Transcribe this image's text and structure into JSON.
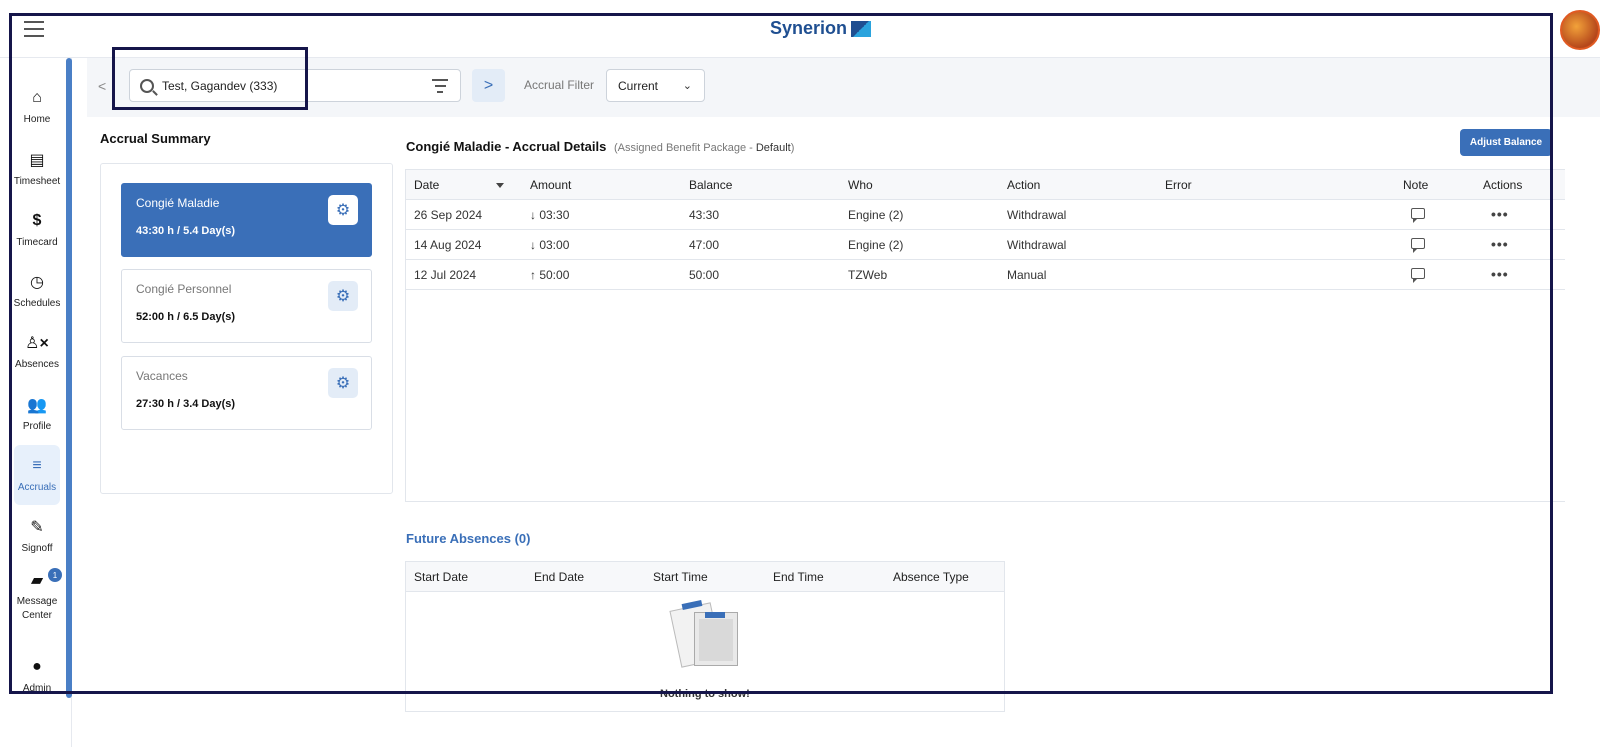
{
  "app": {
    "logo_text": "Synerion",
    "brand_color": "#3a6fb8"
  },
  "sidebar": {
    "items": [
      {
        "label": "Home",
        "icon": "home-icon",
        "glyph": "⌂"
      },
      {
        "label": "Timesheet",
        "icon": "timesheet-icon",
        "glyph": "▤"
      },
      {
        "label": "Timecard",
        "icon": "dollar-icon",
        "glyph": "$"
      },
      {
        "label": "Schedules",
        "icon": "clock-icon",
        "glyph": "◷"
      },
      {
        "label": "Absences",
        "icon": "person-remove-icon",
        "glyph": "♙×"
      },
      {
        "label": "Profile",
        "icon": "people-icon",
        "glyph": "👥"
      },
      {
        "label": "Accruals",
        "icon": "accruals-icon",
        "glyph": "≡"
      },
      {
        "label": "Signoff",
        "icon": "signoff-icon",
        "glyph": "✎"
      },
      {
        "label": "Message\nCenter",
        "icon": "chat-icon",
        "glyph": "▰",
        "badge": "1"
      },
      {
        "label": "Admin",
        "icon": "admin-icon",
        "glyph": "●"
      }
    ]
  },
  "toolbar": {
    "back_glyph": "<",
    "search_value": "Test, Gagandev (333)",
    "next_glyph": ">",
    "accrual_filter_label": "Accrual Filter",
    "accrual_filter_value": "Current"
  },
  "summary": {
    "title": "Accrual Summary",
    "cards": [
      {
        "name": "Congié Maladie",
        "value": "43:30 h / 5.4 Day(s)"
      },
      {
        "name": "Congié Personnel",
        "value": "52:00 h / 6.5 Day(s)"
      },
      {
        "name": "Vacances",
        "value": "27:30 h / 3.4 Day(s)"
      }
    ]
  },
  "details": {
    "title": "Congié Maladie - Accrual Details",
    "sub_prefix": "(Assigned Benefit Package - ",
    "sub_value": "Default",
    "sub_suffix": ")",
    "adjust_label": "Adjust Balance",
    "columns": [
      "Date",
      "Amount",
      "Balance",
      "Who",
      "Action",
      "Error",
      "Note",
      "Actions"
    ],
    "rows": [
      {
        "date": "26 Sep 2024",
        "amount": "↓ 03:30",
        "balance": "43:30",
        "who": "Engine (2)",
        "action": "Withdrawal",
        "error": ""
      },
      {
        "date": "14 Aug 2024",
        "amount": "↓ 03:00",
        "balance": "47:00",
        "who": "Engine (2)",
        "action": "Withdrawal",
        "error": ""
      },
      {
        "date": "12 Jul 2024",
        "amount": "↑ 50:00",
        "balance": "50:00",
        "who": "TZWeb",
        "action": "Manual",
        "error": ""
      }
    ]
  },
  "future": {
    "title": "Future Absences (0)",
    "columns": [
      "Start Date",
      "End Date",
      "Start Time",
      "End Time",
      "Absence Type"
    ],
    "empty_text": "Nothing to show!"
  }
}
